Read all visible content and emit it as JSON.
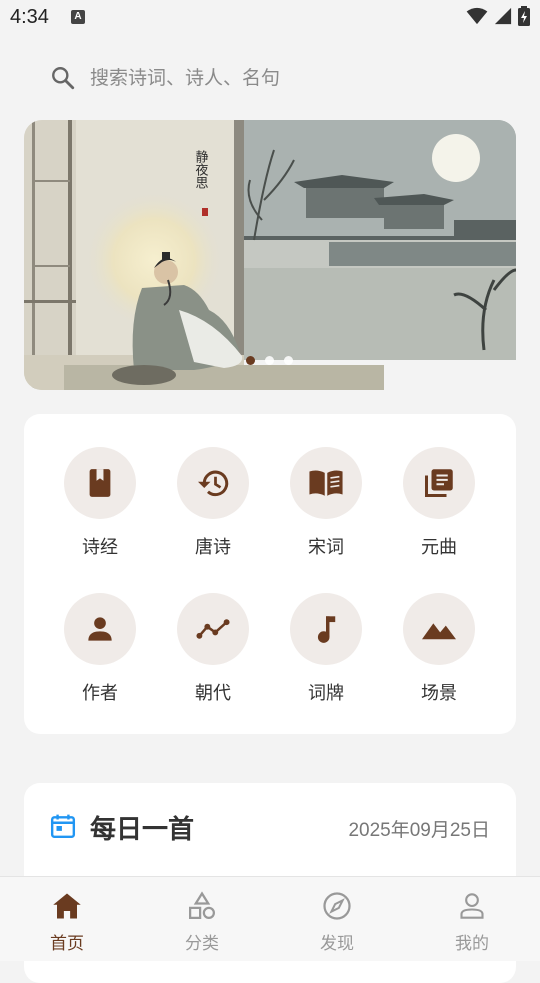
{
  "status_bar": {
    "time": "4:34",
    "notification_glyph": "A"
  },
  "search": {
    "placeholder": "搜索诗词、诗人、名句",
    "icon": "search-icon"
  },
  "banner": {
    "image": "moonlight-poet-painting",
    "calligraphy": "静夜思",
    "slides": 3,
    "active_slide": 0
  },
  "categories": [
    {
      "label": "诗经",
      "icon": "book-icon"
    },
    {
      "label": "唐诗",
      "icon": "history-icon"
    },
    {
      "label": "宋词",
      "icon": "open-book-icon"
    },
    {
      "label": "元曲",
      "icon": "library-icon"
    },
    {
      "label": "作者",
      "icon": "person-icon"
    },
    {
      "label": "朝代",
      "icon": "timeline-icon"
    },
    {
      "label": "词牌",
      "icon": "music-note-icon"
    },
    {
      "label": "场景",
      "icon": "landscape-icon"
    }
  ],
  "daily": {
    "title": "每日一首",
    "date": "2025年09月25日",
    "icon": "calendar-icon"
  },
  "nav": {
    "items": [
      {
        "label": "首页",
        "icon": "home-icon",
        "active": true
      },
      {
        "label": "分类",
        "icon": "category-icon",
        "active": false
      },
      {
        "label": "发现",
        "icon": "compass-icon",
        "active": false
      },
      {
        "label": "我的",
        "icon": "profile-icon",
        "active": false
      }
    ]
  },
  "colors": {
    "accent": "#6a3b20",
    "background": "#f3f3f3",
    "card": "#ffffff",
    "icon_circle": "#f0ebe8",
    "calendar_blue": "#2196f3",
    "inactive": "#999999"
  }
}
